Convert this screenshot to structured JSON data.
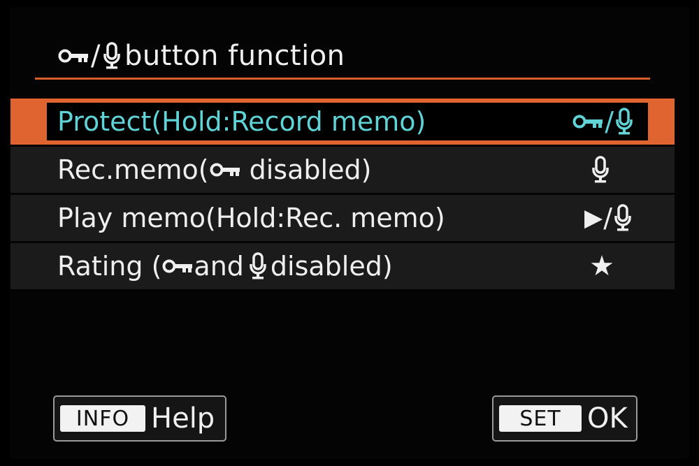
{
  "screen": {
    "title": {
      "slash": "/",
      "text": "button function",
      "icons": [
        "key-icon",
        "microphone-icon"
      ]
    },
    "accent_color": "#e0642f",
    "selected_text_color": "#5fd3d6",
    "menu": {
      "items": [
        {
          "label": "Protect(Hold:Record memo)",
          "value_slash": "/",
          "value_icons": [
            "key-icon",
            "microphone-icon"
          ],
          "selected": true
        },
        {
          "label_prefix": "Rec.memo(",
          "label_suffix": " disabled)",
          "label_icons": [
            "key-icon"
          ],
          "value_icons": [
            "microphone-icon"
          ],
          "selected": false
        },
        {
          "label": "Play memo(Hold:Rec. memo)",
          "value_play": "▶",
          "value_slash": "/",
          "value_icons": [
            "play-icon",
            "microphone-icon"
          ],
          "selected": false
        },
        {
          "label_prefix": "Rating (",
          "label_middle": "and",
          "label_suffix": "disabled)",
          "label_icons": [
            "key-icon",
            "microphone-icon"
          ],
          "value_star": "★",
          "value_icons": [
            "star-icon"
          ],
          "selected": false
        }
      ]
    },
    "footer": {
      "info_key": "INFO",
      "info_label": "Help",
      "set_key": "SET",
      "set_label": "OK"
    }
  }
}
